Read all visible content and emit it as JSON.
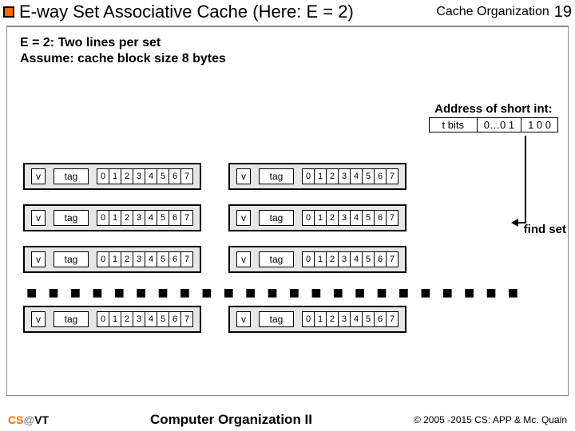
{
  "header": {
    "title": "E-way Set Associative Cache (Here: E = 2)",
    "category": "Cache Organization",
    "page": "19"
  },
  "assumptions": {
    "line1": "E = 2: Two lines per set",
    "line2": "Assume: cache block size 8 bytes"
  },
  "address": {
    "label": "Address of short int:",
    "tbits": "t bits",
    "sbits": "0…0 1",
    "bbits": "1 0 0"
  },
  "cacheline": {
    "v": "v",
    "tag": "tag",
    "bytes": [
      "0",
      "1",
      "2",
      "3",
      "4",
      "5",
      "6",
      "7"
    ]
  },
  "annotation": {
    "findset": "find set"
  },
  "footer": {
    "course_cs": "CS",
    "course_at": "@",
    "course_vt": "VT",
    "center": "Computer Organization II",
    "copyright": "© 2005 -2015 CS: APP & Mc. Quain"
  }
}
